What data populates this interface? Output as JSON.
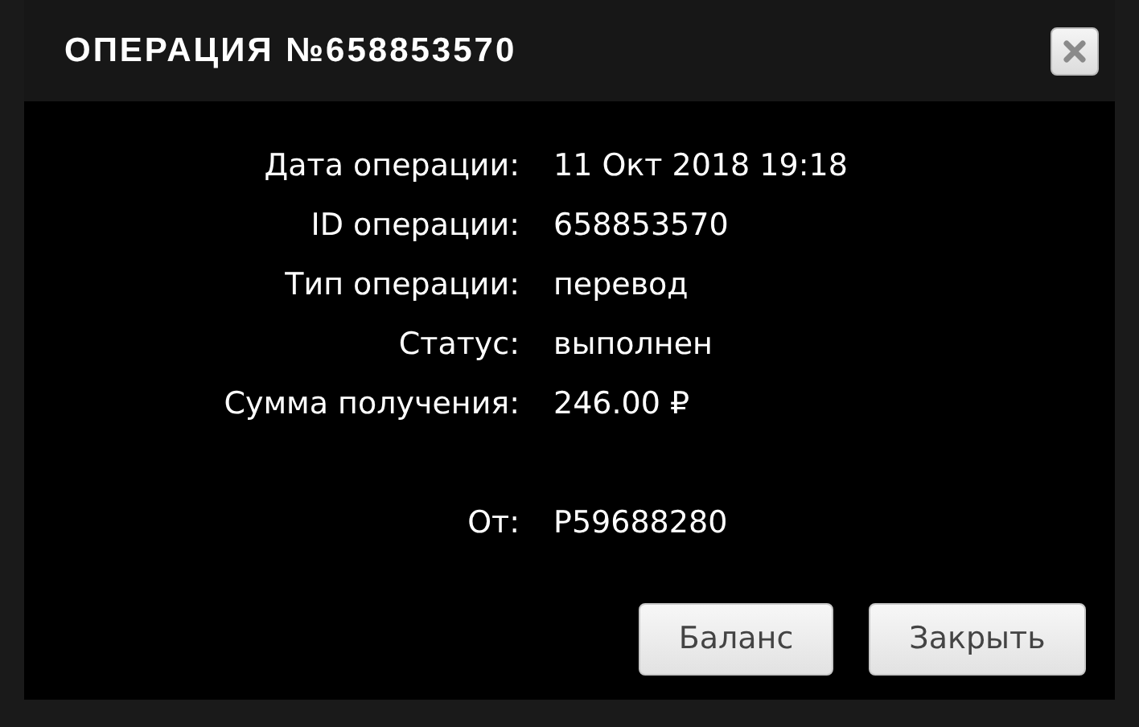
{
  "dialog": {
    "title": "ОПЕРАЦИЯ №658853570"
  },
  "details": [
    {
      "label": "Дата операции:",
      "value": "11 Окт 2018 19:18"
    },
    {
      "label": "ID операции:",
      "value": "658853570"
    },
    {
      "label": "Тип операции:",
      "value": "перевод"
    },
    {
      "label": "Статус:",
      "value": "выполнен"
    },
    {
      "label": "Сумма получения:",
      "value": "246.00 ₽"
    }
  ],
  "sender": {
    "label": "От:",
    "value": "P59688280"
  },
  "buttons": [
    "Баланс",
    "Закрыть"
  ]
}
